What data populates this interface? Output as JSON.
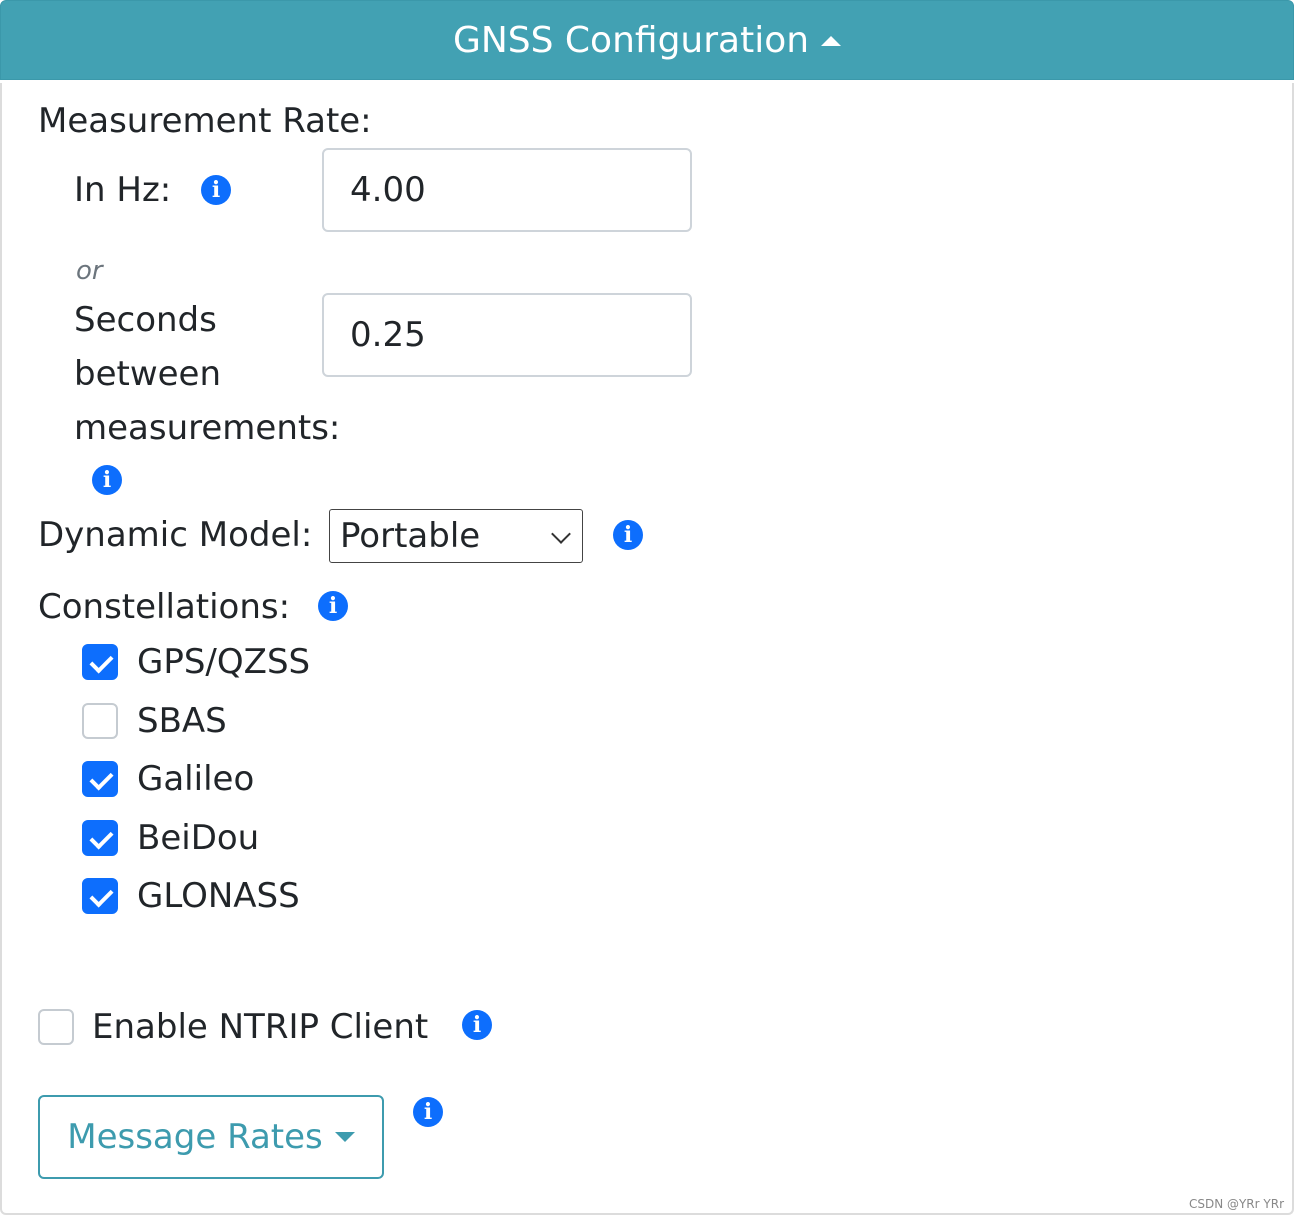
{
  "header": {
    "title": "GNSS Configuration"
  },
  "measurement": {
    "heading": "Measurement Rate:",
    "hz_label": "In Hz:",
    "hz_value": "4.00",
    "or_text": "or",
    "seconds_label_1": "Seconds",
    "seconds_label_2": "between",
    "seconds_label_3": "measurements:",
    "seconds_value": "0.25"
  },
  "dynamic_model": {
    "label": "Dynamic Model:",
    "selected": "Portable"
  },
  "constellations": {
    "label": "Constellations:",
    "items": [
      {
        "label": "GPS/QZSS",
        "checked": true
      },
      {
        "label": "SBAS",
        "checked": false
      },
      {
        "label": "Galileo",
        "checked": true
      },
      {
        "label": "BeiDou",
        "checked": true
      },
      {
        "label": "GLONASS",
        "checked": true
      }
    ]
  },
  "ntrip": {
    "label": "Enable NTRIP Client",
    "checked": false
  },
  "message_rates": {
    "label": "Message Rates"
  },
  "watermark": "CSDN @YRr YRr",
  "icons": {
    "info": "info-icon",
    "caret_up": "caret-up-icon",
    "caret_down": "caret-down-icon",
    "chevron": "chevron-down-icon"
  },
  "colors": {
    "header_bg": "#42a1b3",
    "accent": "#0d6efd",
    "outline_button": "#3d9bae"
  }
}
